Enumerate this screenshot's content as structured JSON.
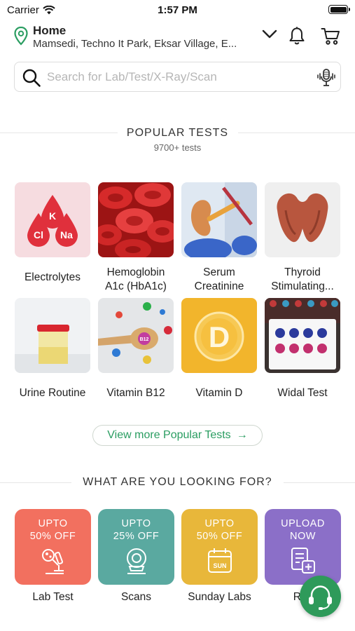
{
  "status_bar": {
    "carrier": "Carrier",
    "time": "1:57 PM"
  },
  "header": {
    "location_title": "Home",
    "location_address": "Mamsedi, Techno It Park, Eksar Village, E...",
    "icons": [
      "location-pin-icon",
      "chevron-down-icon",
      "bell-icon",
      "cart-icon"
    ]
  },
  "search": {
    "placeholder": "Search for Lab/Test/X-Ray/Scan",
    "value": ""
  },
  "popular": {
    "title": "POPULAR TESTS",
    "subtitle": "9700+ tests",
    "electrolyte_symbols": [
      "K",
      "Cl",
      "Na"
    ],
    "vitamin_b12_mark": "B12",
    "vitamin_d_mark": "D",
    "sunday_mark": "SUN",
    "tests": [
      {
        "label": "Electrolytes"
      },
      {
        "label": "Hemoglobin A1c (HbA1c)"
      },
      {
        "label": "Serum Creatinine"
      },
      {
        "label": "Thyroid Stimulating..."
      },
      {
        "label": "Urine Routine"
      },
      {
        "label": "Vitamin B12"
      },
      {
        "label": "Vitamin D"
      },
      {
        "label": "Widal Test"
      }
    ],
    "view_more": "View more Popular Tests",
    "view_more_arrow": "→"
  },
  "looking_for": {
    "title": "WHAT ARE YOU LOOKING FOR?",
    "categories": [
      {
        "line1": "UPTO",
        "line2": "50% OFF",
        "label": "Lab Test",
        "color": "#f2705f",
        "icon": "microscope-icon"
      },
      {
        "line1": "UPTO",
        "line2": "25% OFF",
        "label": "Scans",
        "color": "#5aa9a0",
        "icon": "mri-scanner-icon"
      },
      {
        "line1": "UPTO",
        "line2": "50% OFF",
        "label": "Sunday Labs",
        "color": "#e8b73a",
        "icon": "calendar-icon"
      },
      {
        "line1": "UPLOAD",
        "line2": "NOW",
        "label": "Rec",
        "color": "#8b6fc8",
        "icon": "prescription-upload-icon"
      }
    ]
  },
  "colors": {
    "brand_green": "#2a9d61",
    "support_green": "#2e9a5a"
  }
}
